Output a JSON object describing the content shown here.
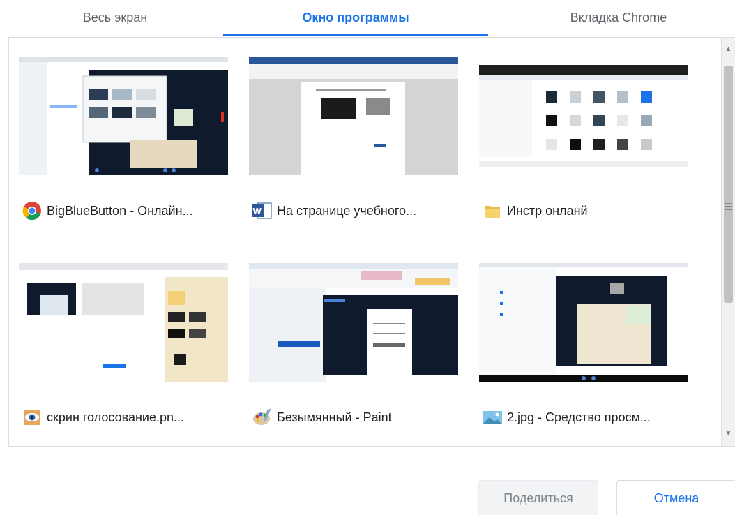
{
  "tabs": [
    {
      "label": "Весь экран"
    },
    {
      "label": "Окно программы"
    },
    {
      "label": "Вкладка Chrome"
    }
  ],
  "windows": [
    {
      "title": "BigBlueButton - Онлайн...",
      "icon": "chrome-icon"
    },
    {
      "title": "На странице учебного...",
      "icon": "word-icon"
    },
    {
      "title": "Инстр онланй",
      "icon": "folder-icon"
    },
    {
      "title": "скрин голосование.pn...",
      "icon": "image-viewer-eye-icon"
    },
    {
      "title": "Безымянный - Paint",
      "icon": "paint-icon"
    },
    {
      "title": "2.jpg - Средство просм...",
      "icon": "photo-viewer-icon"
    }
  ],
  "buttons": {
    "share": "Поделиться",
    "cancel": "Отмена"
  },
  "colors": {
    "accent": "#1a73e8",
    "disabled_text": "#80868b"
  }
}
